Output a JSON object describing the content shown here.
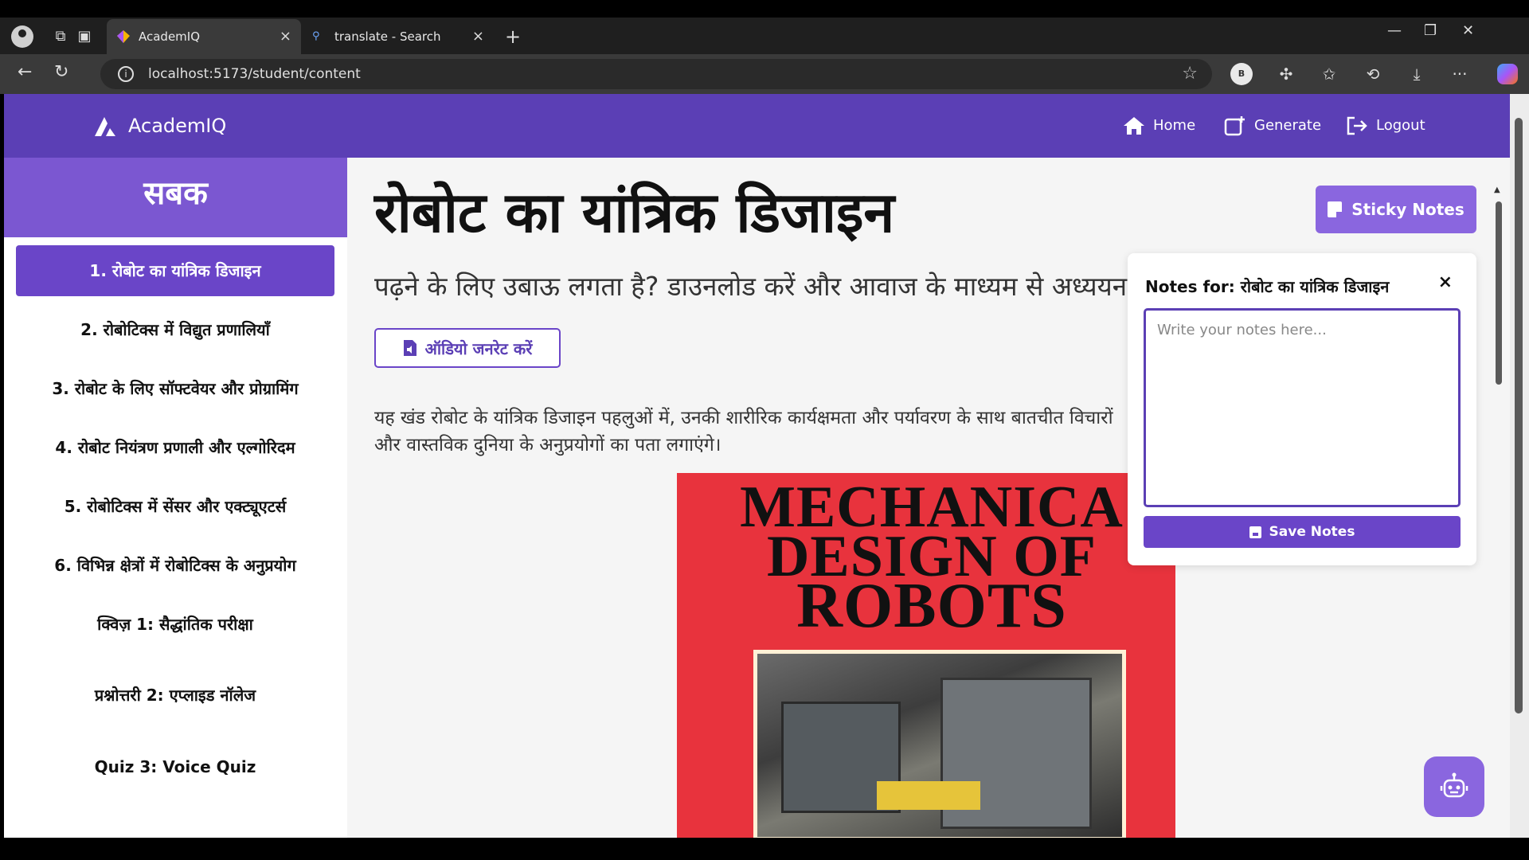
{
  "browser": {
    "tabs": [
      {
        "title": "AcademIQ",
        "active": true
      },
      {
        "title": "translate - Search",
        "active": false
      }
    ],
    "url": "localhost:5173/student/content",
    "profile_badge": "B"
  },
  "header": {
    "brand": "AcademIQ",
    "nav": {
      "home": "Home",
      "generate": "Generate",
      "logout": "Logout"
    }
  },
  "sidebar": {
    "title": "सबक",
    "items": [
      {
        "label": "1. रोबोट का यांत्रिक डिजाइन",
        "active": true
      },
      {
        "label": "2. रोबोटिक्स में विद्युत प्रणालियाँ",
        "active": false
      },
      {
        "label": "3. रोबोट के लिए सॉफ्टवेयर और प्रोग्रामिंग",
        "active": false
      },
      {
        "label": "4. रोबोट नियंत्रण प्रणाली और एल्गोरिदम",
        "active": false
      },
      {
        "label": "5. रोबोटिक्स में सेंसर और एक्ट्यूएटर्स",
        "active": false
      },
      {
        "label": "6. विभिन्न क्षेत्रों में रोबोटिक्स के अनुप्रयोग",
        "active": false
      },
      {
        "label": "क्विज़ 1: सैद्धांतिक परीक्षा",
        "active": false
      },
      {
        "label": "प्रश्नोत्तरी 2: एप्लाइड नॉलेज",
        "active": false
      },
      {
        "label": "Quiz 3: Voice Quiz",
        "active": false
      }
    ]
  },
  "content": {
    "title": "रोबोट का यांत्रिक डिजाइन",
    "subtitle": "पढ़ने के लिए उबाऊ लगता है? डाउनलोड करें और आवाज के माध्यम से अध्ययन",
    "audio_button": "ऑडियो जनरेट करें",
    "paragraph": "यह खंड रोबोट के यांत्रिक डिजाइन पहलुओं में, उनकी शारीरिक कार्यक्षमता और पर्यावरण के साथ बातचीत विचारों और वास्तविक दुनिया के अनुप्रयोगों का पता लगाएंगे।",
    "book_cover": {
      "line1": "MECHANICA",
      "line2": "DESIGN OF",
      "line3": "ROBOTS"
    }
  },
  "sticky_notes": {
    "button": "Sticky Notes",
    "panel_title": "Notes for: रोबोट का यांत्रिक डिजाइन",
    "close": "×",
    "placeholder": "Write your notes here...",
    "save": "Save Notes"
  },
  "icons": [
    "home-icon",
    "generate-icon",
    "logout-icon",
    "audio-file-icon",
    "note-icon",
    "save-icon",
    "robot-icon"
  ],
  "colors": {
    "header": "#5b3fb5",
    "accent": "#6a45c8",
    "sidebar_head": "#7b57d1",
    "sticky": "#8a66df"
  }
}
